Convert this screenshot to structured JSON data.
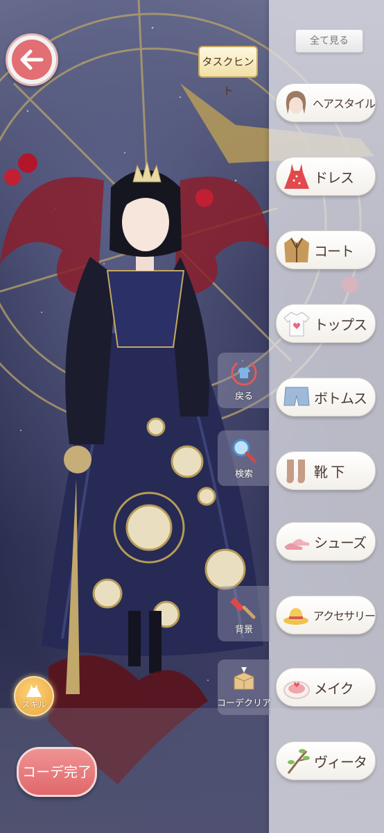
{
  "back_button": {
    "icon": "arrow-left-icon"
  },
  "task_hint": {
    "label": "タスクヒント"
  },
  "view_all": {
    "label": "全て見る"
  },
  "categories": [
    {
      "label": "ヘアスタイル",
      "icon": "hair-icon"
    },
    {
      "label": "ドレス",
      "icon": "dress-icon"
    },
    {
      "label": "コート",
      "icon": "coat-icon"
    },
    {
      "label": "トップス",
      "icon": "tshirt-icon"
    },
    {
      "label": "ボトムス",
      "icon": "shorts-icon"
    },
    {
      "label": "靴 下",
      "icon": "socks-icon"
    },
    {
      "label": "シューズ",
      "icon": "heels-icon"
    },
    {
      "label": "アクセサリー",
      "icon": "hat-icon"
    },
    {
      "label": "メイク",
      "icon": "compact-icon"
    },
    {
      "label": "ヴィータ",
      "icon": "branch-icon"
    }
  ],
  "tools": {
    "undo": "戻る",
    "search": "検索",
    "background": "背景",
    "clear": "コーデクリア"
  },
  "skill": {
    "label": "スキル"
  },
  "finish": {
    "label": "コーデ完了"
  },
  "colors": {
    "accent": "#e26f73",
    "gold": "#c8a860",
    "panel": "#e1e1e8",
    "label_text": "#4a3a33"
  }
}
